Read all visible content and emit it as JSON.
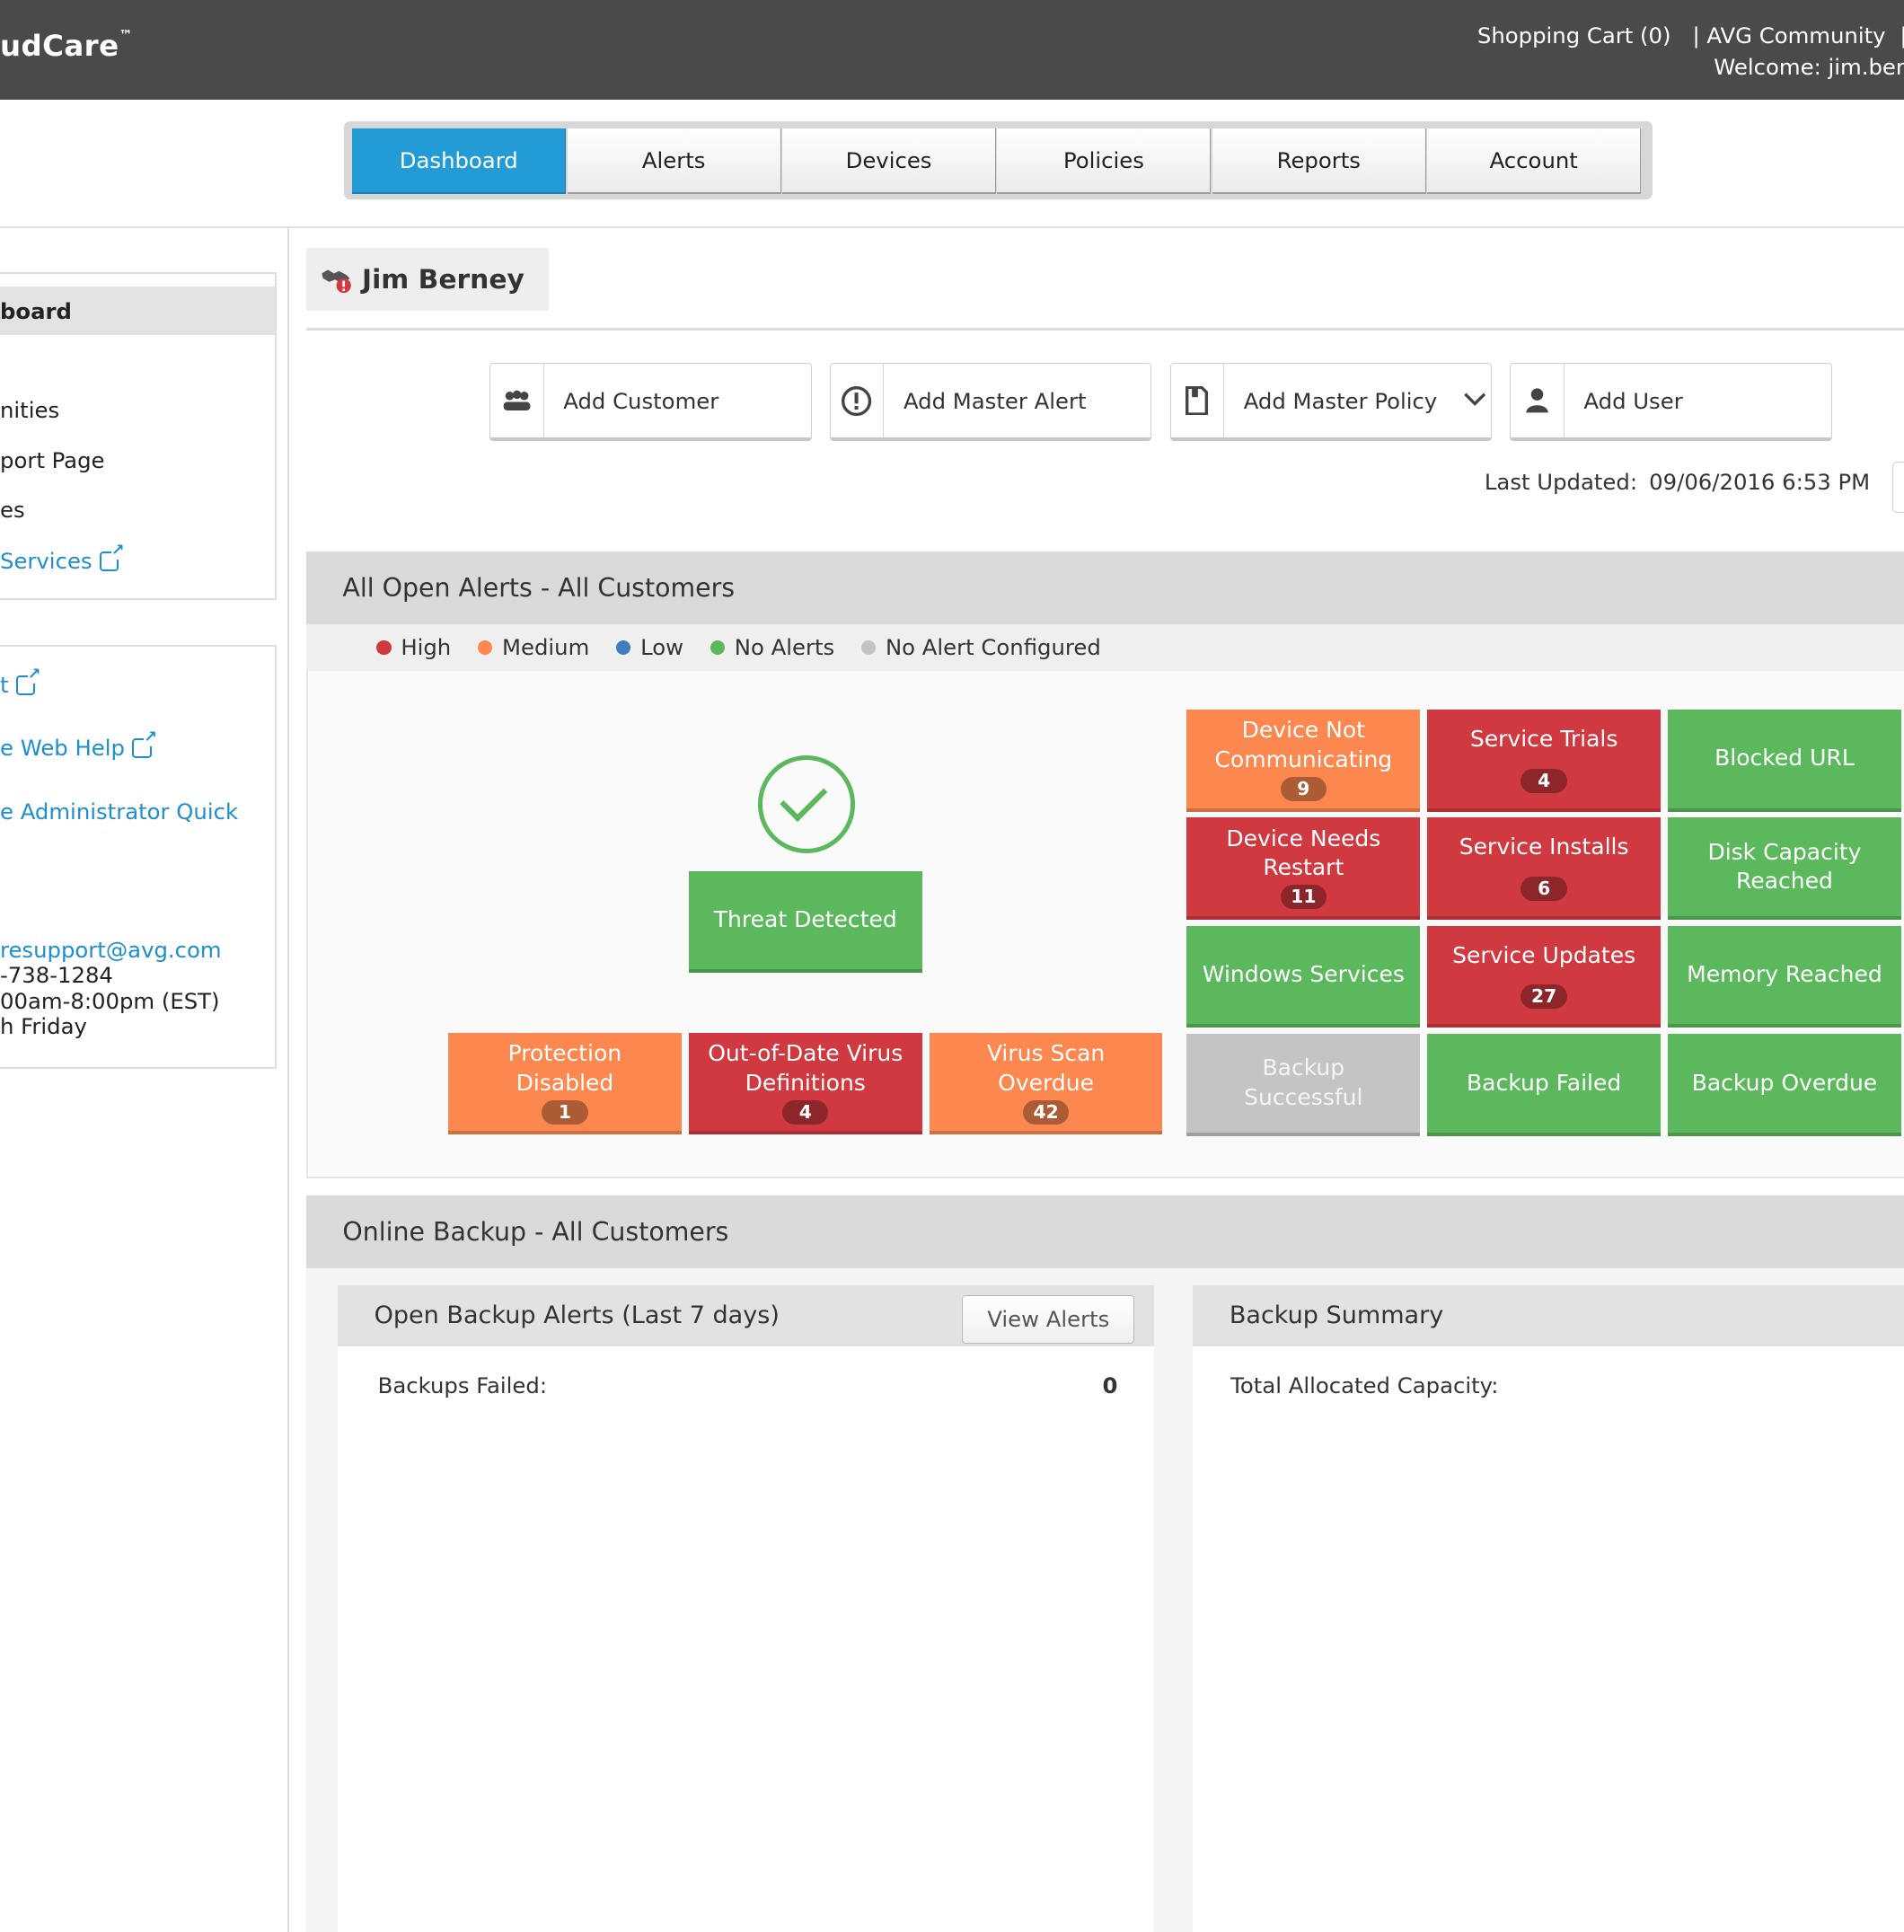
{
  "topbar": {
    "brand": "udCare",
    "brand_tm": "™",
    "shopping_cart": "Shopping Cart (0)",
    "community": "| AVG Community",
    "trail_sep": "|",
    "welcome": "Welcome: jim.ber"
  },
  "nav": {
    "tabs": [
      {
        "label": "Dashboard",
        "active": true
      },
      {
        "label": "Alerts"
      },
      {
        "label": "Devices"
      },
      {
        "label": "Policies"
      },
      {
        "label": "Reports"
      },
      {
        "label": "Account"
      }
    ]
  },
  "sidebar": {
    "active_item": "board",
    "items": [
      "nities",
      "port Page",
      "es"
    ],
    "services_link": " Services",
    "links2": [
      "t",
      "e Web Help",
      "e Administrator Quick"
    ],
    "support_email": "resupport@avg.com",
    "support_phone": "-738-1284",
    "support_hours": "00am-8:00pm (EST)",
    "support_days": "h Friday"
  },
  "customer": {
    "name": "Jim Berney"
  },
  "actions": {
    "add_customer": "Add Customer",
    "add_master_alert": "Add Master Alert",
    "add_master_policy": "Add Master Policy",
    "add_user": "Add User"
  },
  "last_updated": {
    "label": "Last Updated:",
    "value": "09/06/2016 6:53 PM"
  },
  "alerts_section": {
    "title": "All Open Alerts - All Customers",
    "legend": [
      {
        "label": "High",
        "color": "#d0393f"
      },
      {
        "label": "Medium",
        "color": "#fd884f"
      },
      {
        "label": "Low",
        "color": "#3f7fc1"
      },
      {
        "label": "No Alerts",
        "color": "#5cb85c"
      },
      {
        "label": "No Alert Configured",
        "color": "#c4c4c4"
      }
    ],
    "threat_detected": "Threat Detected",
    "protection_disabled": {
      "label": "Protection Disabled",
      "count": "1"
    },
    "outdated_defs": {
      "label": "Out-of-Date Virus Definitions",
      "count": "4"
    },
    "scan_overdue": {
      "label": "Virus Scan Overdue",
      "count": "42"
    },
    "device_not_comm": {
      "label": "Device Not Communicating",
      "count": "9"
    },
    "service_trials": {
      "label": "Service Trials",
      "count": "4"
    },
    "blocked_url": {
      "label": "Blocked URL"
    },
    "needs_restart": {
      "label": "Device Needs Restart",
      "count": "11"
    },
    "service_installs": {
      "label": "Service Installs",
      "count": "6"
    },
    "disk_capacity": {
      "label": "Disk Capacity Reached"
    },
    "windows_services": {
      "label": "Windows Services"
    },
    "service_updates": {
      "label": "Service Updates",
      "count": "27"
    },
    "memory_reached": {
      "label": "Memory Reached"
    },
    "backup_successful": {
      "label": "Backup Successful"
    },
    "backup_failed": {
      "label": "Backup Failed"
    },
    "backup_overdue": {
      "label": "Backup Overdue"
    }
  },
  "backup_section": {
    "title": "Online Backup - All Customers",
    "open_alerts_title": "Open Backup Alerts (Last 7 days)",
    "view_alerts": "View Alerts",
    "backups_failed_label": "Backups Failed:",
    "backups_failed_value": "0",
    "summary_title": "Backup Summary",
    "total_allocated_label": "Total Allocated Capacity:"
  },
  "icons": {
    "add_customer": "group-icon",
    "add_master_alert": "alert-circle-icon",
    "add_master_policy": "document-icon",
    "add_user": "user-icon",
    "customer": "handshake-icon",
    "external_link": "external-link-icon"
  }
}
